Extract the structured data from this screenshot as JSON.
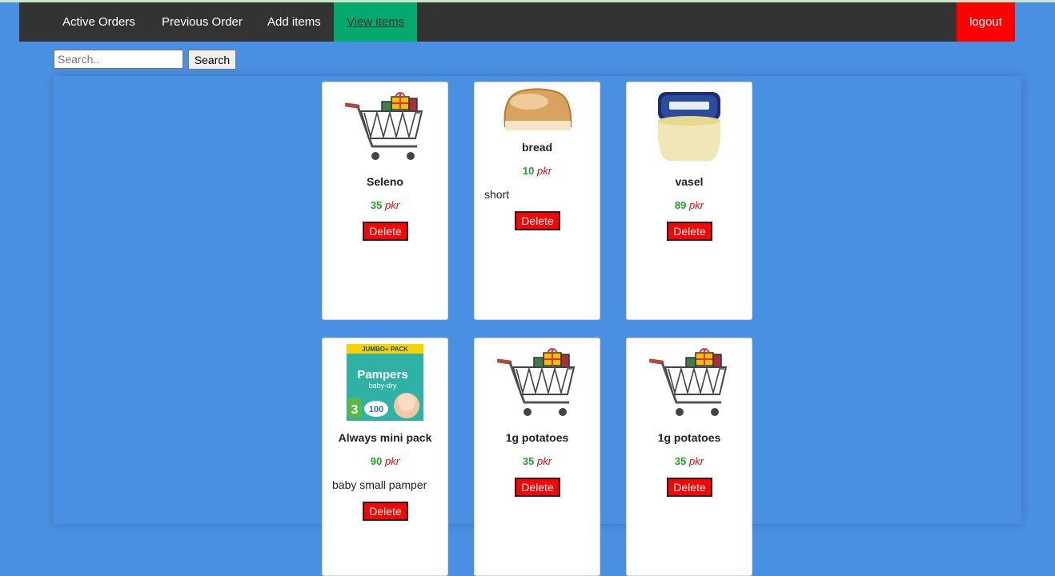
{
  "nav": {
    "items": [
      {
        "label": "Active Orders"
      },
      {
        "label": "Previous Order"
      },
      {
        "label": "Add items"
      },
      {
        "label": "View items"
      }
    ],
    "logout_label": "logout",
    "active_color": "#04aa6d",
    "logout_color": "#ff0000"
  },
  "search": {
    "placeholder": "Search..",
    "button_label": "Search"
  },
  "products": [
    {
      "name": "Seleno",
      "price": "35",
      "currency": "pkr",
      "description": "",
      "image": "cart-icon",
      "delete_label": "Delete"
    },
    {
      "name": "bread",
      "price": "10",
      "currency": "pkr",
      "description": "short",
      "image": "bread-image",
      "delete_label": "Delete"
    },
    {
      "name": "vasel",
      "price": "89",
      "currency": "pkr",
      "description": "",
      "image": "vaseline-jar-image",
      "delete_label": "Delete"
    },
    {
      "name": "Always mini pack",
      "price": "90",
      "currency": "pkr",
      "description": "baby small pamper",
      "image": "pampers-pack-image",
      "image_text": [
        "JUMBO+ PACK",
        "Pampers",
        "baby-dry",
        "3",
        "100"
      ],
      "delete_label": "Delete"
    },
    {
      "name": "1g potatoes",
      "price": "35",
      "currency": "pkr",
      "description": "",
      "image": "cart-icon",
      "delete_label": "Delete"
    },
    {
      "name": "1g potatoes",
      "price": "35",
      "currency": "pkr",
      "description": "",
      "image": "cart-icon",
      "delete_label": "Delete"
    }
  ],
  "colors": {
    "background": "#4a90e2",
    "price": "#1fa22e",
    "currency": "#ff0000",
    "delete": "#ff0000"
  }
}
